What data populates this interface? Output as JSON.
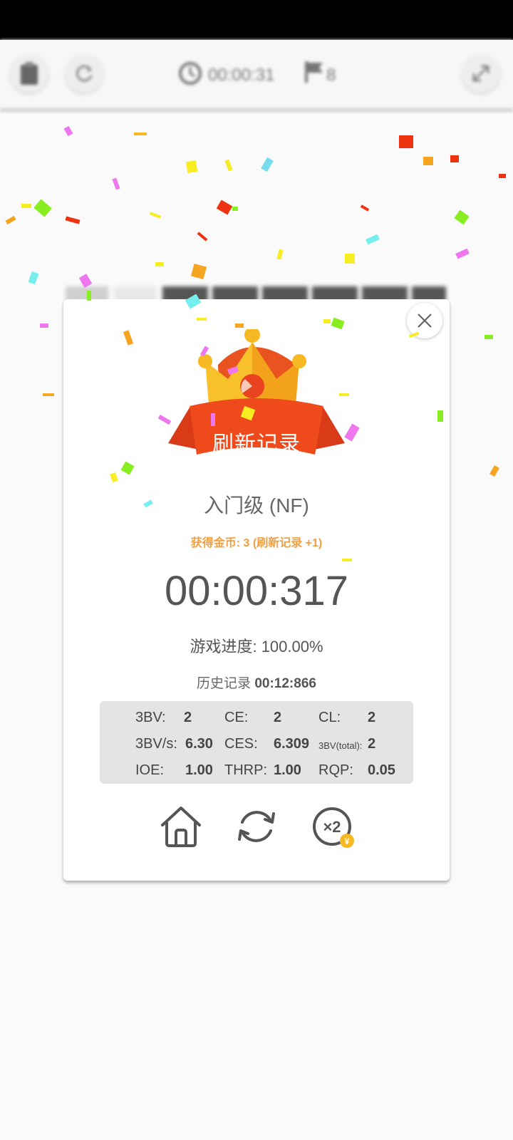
{
  "topbar": {
    "timer": "00:00:31",
    "flags": "8"
  },
  "modal": {
    "banner": "刷新记录",
    "level": "入门级 (NF)",
    "coins": "获得金币: 3 (刷新记录 +1)",
    "time": "00:00:317",
    "progress_label": "游戏进度:",
    "progress_value": "100.00%",
    "history_label": "历史记录",
    "history_value": "00:12:866",
    "stats": [
      {
        "label": "3BV:",
        "value": "2"
      },
      {
        "label": "CE:",
        "value": "2"
      },
      {
        "label": "CL:",
        "value": "2"
      },
      {
        "label": "3BV/s:",
        "value": "6.30"
      },
      {
        "label": "CES:",
        "value": "6.309"
      },
      {
        "label": "3BV(total):",
        "value": "2"
      },
      {
        "label": "IOE:",
        "value": "1.00"
      },
      {
        "label": "THRP:",
        "value": "1.00"
      },
      {
        "label": "RQP:",
        "value": "0.05"
      }
    ],
    "double_label": "×2"
  },
  "colors": {
    "banner_red": "#e8431e",
    "crown_gold": "#f6b823",
    "coin_text": "#f0a040"
  },
  "icons": [
    "clipboard-icon",
    "refresh-icon",
    "clock-icon",
    "flag-icon",
    "expand-icon",
    "close-icon",
    "crown-icon",
    "home-icon",
    "restart-icon",
    "double-coins-icon"
  ]
}
